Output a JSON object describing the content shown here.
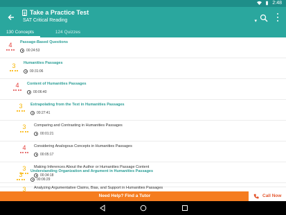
{
  "status_bar": {
    "time": "2:48"
  },
  "app_bar": {
    "title": "Take a Practice Test",
    "subtitle": "SAT Critical Reading",
    "subtitle_caret": "▾",
    "back_icon": "back-arrow-icon",
    "search_icon": "search-icon",
    "menu_icon": "overflow-menu-icon"
  },
  "tabs": [
    {
      "label": "130 Concepts",
      "active": true
    },
    {
      "label": "124 Quizzes",
      "active": false
    }
  ],
  "concepts": [
    {
      "title": "Passage-Based Questions",
      "time": "00:24:53",
      "level": "4",
      "style": "bold"
    },
    {
      "title": "Humanities Passages",
      "time": "00:31:06",
      "level": "3",
      "style": "bold"
    },
    {
      "title": "Content of Humanities Passages",
      "time": "00:06:40",
      "level": "4",
      "style": "bold"
    },
    {
      "title": "Extrapolating from the Text in Humanities Passages",
      "time": "00:27:41",
      "level": "3",
      "style": "bold"
    },
    {
      "title": "Comparing and Contrasting in Humanities Passages",
      "time": "00:01:21",
      "level": "3",
      "style": "plain"
    },
    {
      "title": "Considering Analogous Concepts in Humanities Passages",
      "time": "00:05:17",
      "level": "4",
      "style": "plain"
    },
    {
      "title": "Making Inferences About the Author or Humanities Passage Content",
      "time": "00:34:18",
      "level": "3",
      "style": "plain"
    },
    {
      "title": "Understanding Organization and Argument in Humanities Passages",
      "time": "00:06:29",
      "level": "3",
      "style": "bold"
    },
    {
      "title": "Analyzing Argumentative Claims, Bias, and Support in Humanities Passages",
      "time": "",
      "level": "3",
      "style": "plain"
    }
  ],
  "help_bar": {
    "text": "Need Help? Find a Tutor",
    "call_label": "Call Now",
    "call_icon": "phone-icon"
  },
  "nav_bar": {
    "back_icon": "nav-back-icon",
    "home_icon": "nav-home-icon",
    "recents_icon": "nav-recents-icon"
  },
  "colors": {
    "app_bar": "#2aa79e",
    "accent_text": "#2b9e96",
    "help_bar": "#f57c1f",
    "level_red": "#e53935",
    "level_yellow": "#f6b400"
  }
}
